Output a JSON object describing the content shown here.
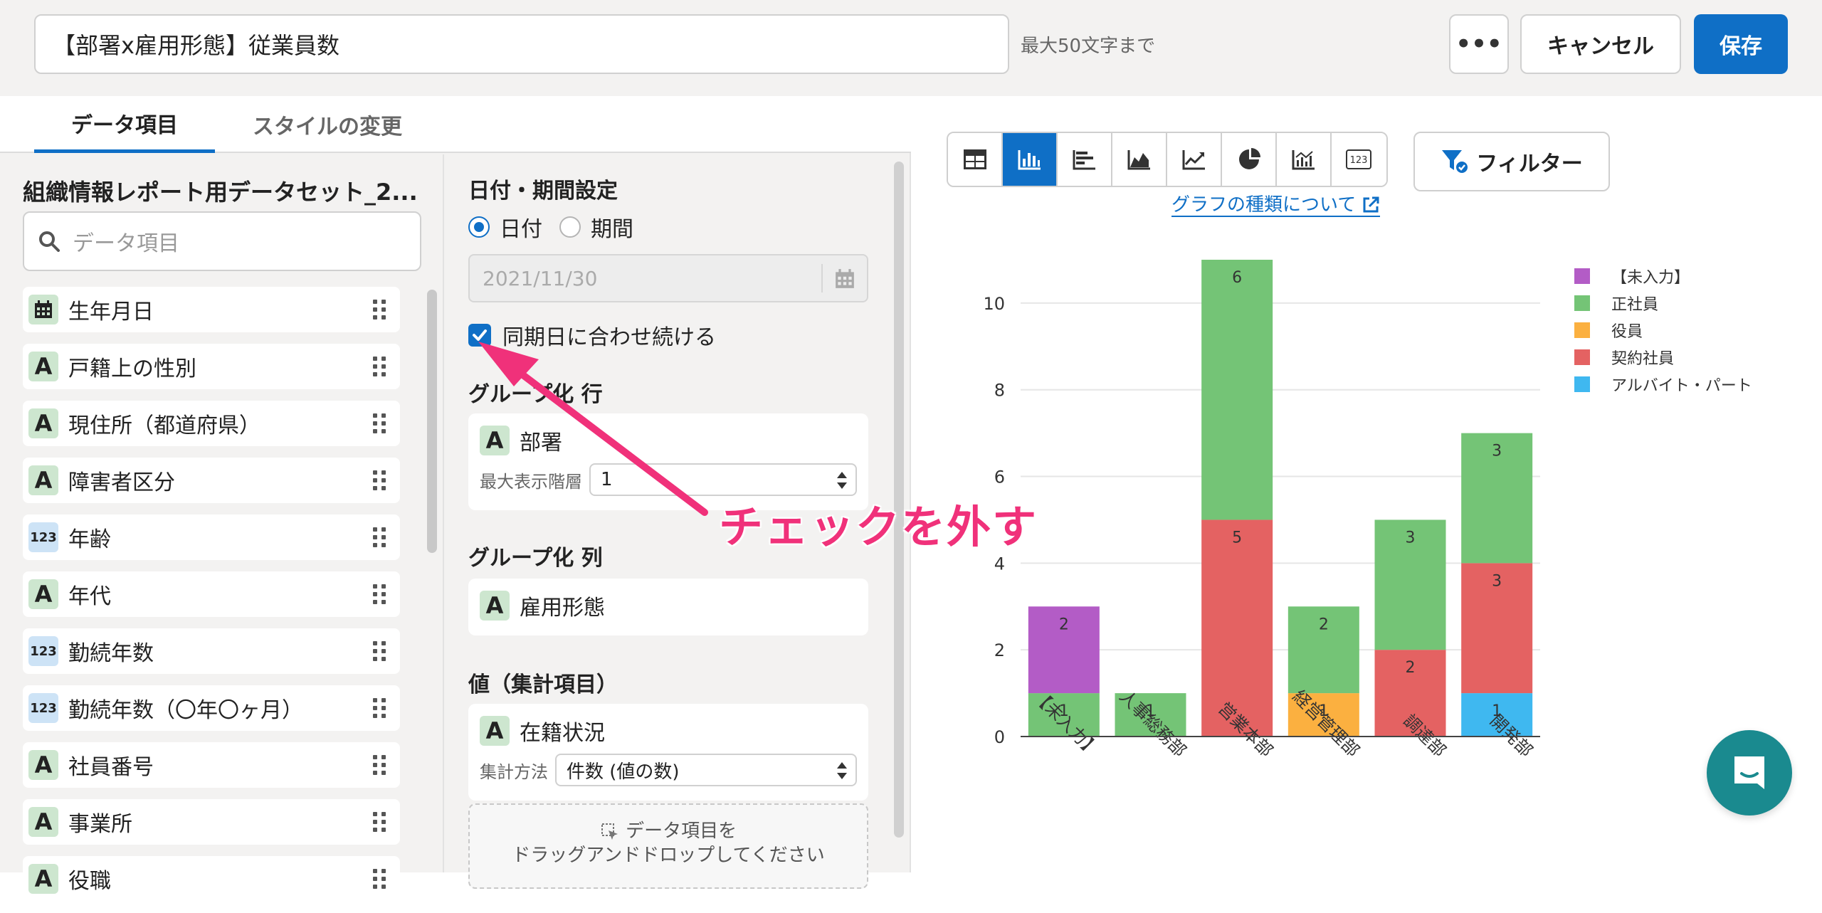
{
  "header": {
    "report_title": "【部署x雇用形態】従業員数",
    "char_limit": "最大50文字まで",
    "more_label": "•••",
    "cancel_label": "キャンセル",
    "save_label": "保存"
  },
  "tabs": [
    {
      "label": "データ項目",
      "active": true
    },
    {
      "label": "スタイルの変更",
      "active": false
    }
  ],
  "dataset": {
    "title": "組織情報レポート用データセット_2...",
    "search_placeholder": "データ項目",
    "fields": [
      {
        "type": "date",
        "label": "生年月日"
      },
      {
        "type": "A",
        "label": "戸籍上の性別"
      },
      {
        "type": "A",
        "label": "現住所（都道府県）"
      },
      {
        "type": "A",
        "label": "障害者区分"
      },
      {
        "type": "123",
        "label": "年齢"
      },
      {
        "type": "A",
        "label": "年代"
      },
      {
        "type": "123",
        "label": "勤続年数"
      },
      {
        "type": "123",
        "label": "勤続年数（〇年〇ヶ月）"
      },
      {
        "type": "A",
        "label": "社員番号"
      },
      {
        "type": "A",
        "label": "事業所"
      },
      {
        "type": "A",
        "label": "役職"
      }
    ]
  },
  "settings": {
    "date_section_title": "日付・期間設定",
    "radio_date": "日付",
    "radio_period": "期間",
    "date_value": "2021/11/30",
    "sync_checkbox": "同期日に合わせ続ける",
    "group_row_title": "グループ化 行",
    "group_row_field": "部署",
    "max_level_label": "最大表示階層",
    "max_level_value": "1",
    "group_col_title": "グループ化 列",
    "group_col_field": "雇用形態",
    "value_title": "値（集計項目）",
    "value_field": "在籍状況",
    "agg_label": "集計方法",
    "agg_value": "件数 (値の数)",
    "drop_line1": "データ項目を",
    "drop_line2": "ドラッグアンドドロップしてください"
  },
  "chart_toolbar": {
    "types": [
      "table",
      "bar",
      "horizontal-bar",
      "area",
      "line",
      "pie",
      "combo",
      "number"
    ],
    "active": "bar",
    "filter_label": "フィルター",
    "link_label": "グラフの種類について"
  },
  "annotation": {
    "text": "チェックを外す"
  },
  "chart_data": {
    "type": "bar",
    "stacked": true,
    "categories": [
      "【未入力】",
      "人事総務部",
      "営業本部",
      "経営管理部",
      "調達部",
      "開発部"
    ],
    "series": [
      {
        "name": "アルバイト・パート",
        "color": "#3fb8f0",
        "values": [
          0,
          0,
          0,
          0,
          0,
          1
        ]
      },
      {
        "name": "契約社員",
        "color": "#e46262",
        "values": [
          0,
          0,
          5,
          0,
          2,
          3
        ]
      },
      {
        "name": "役員",
        "color": "#fbb040",
        "values": [
          0,
          0,
          0,
          1,
          0,
          0
        ]
      },
      {
        "name": "正社員",
        "color": "#74c476",
        "values": [
          1,
          1,
          6,
          2,
          3,
          3
        ]
      },
      {
        "name": "【未入力】",
        "color": "#b35cc6",
        "values": [
          2,
          0,
          0,
          0,
          0,
          0
        ]
      }
    ],
    "legend_order": [
      "【未入力】",
      "正社員",
      "役員",
      "契約社員",
      "アルバイト・パート"
    ],
    "yticks": [
      0,
      2,
      4,
      6,
      8,
      10
    ],
    "ylim": [
      0,
      11
    ],
    "legend_position": "top-right",
    "grid": true
  }
}
